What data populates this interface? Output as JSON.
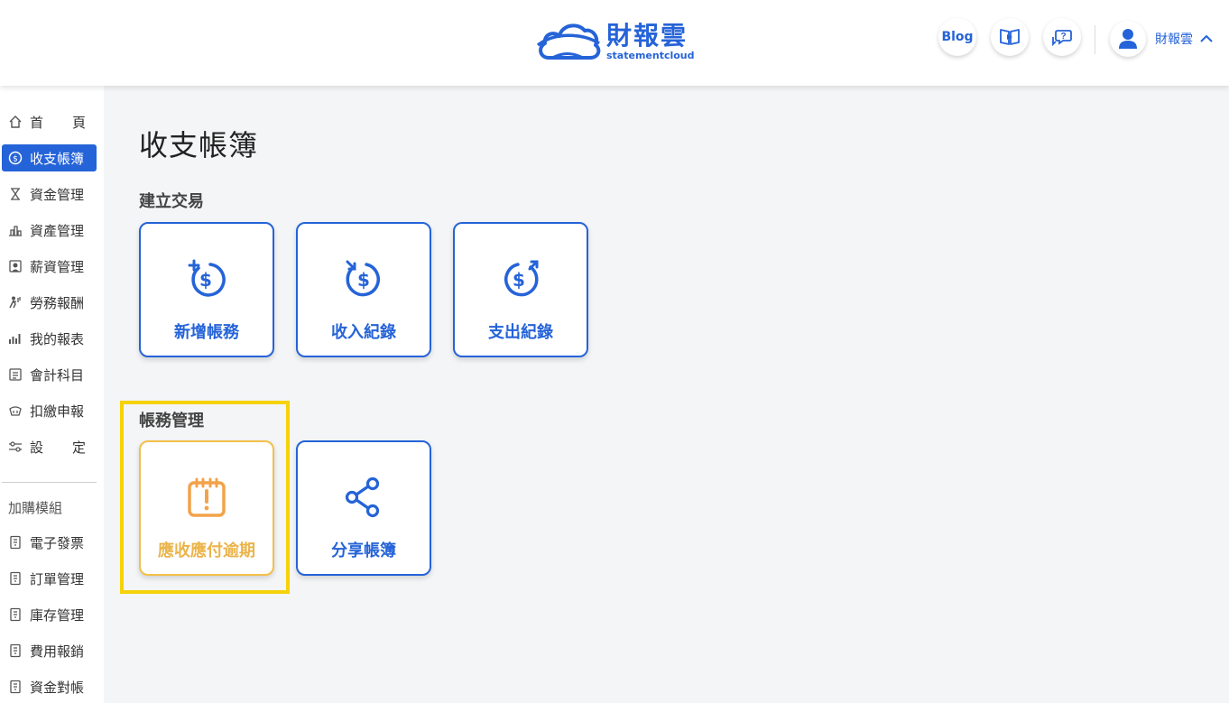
{
  "header": {
    "logo_title": "財報雲",
    "logo_sub": "statementcloud",
    "blog_label": "Blog",
    "video_icon": "video-book-icon",
    "help_icon": "help-chat-icon",
    "user_name": "財報雲"
  },
  "sidebar": {
    "items": [
      {
        "label": "首頁",
        "label_a": "首",
        "label_b": "頁",
        "icon": "home-icon"
      },
      {
        "label": "收支帳簿",
        "icon": "dollar-cycle-icon"
      },
      {
        "label": "資金管理",
        "icon": "hourglass-icon"
      },
      {
        "label": "資產管理",
        "icon": "buildings-icon"
      },
      {
        "label": "薪資管理",
        "icon": "payroll-icon"
      },
      {
        "label": "勞務報酬",
        "icon": "worker-icon"
      },
      {
        "label": "我的報表",
        "icon": "bar-chart-icon"
      },
      {
        "label": "會計科目",
        "icon": "ledger-icon"
      },
      {
        "label": "扣繳申報",
        "icon": "tax-icon"
      },
      {
        "label": "設定",
        "label_a": "設",
        "label_b": "定",
        "icon": "settings-sliders-icon"
      }
    ],
    "addon_title": "加購模組",
    "addons": [
      {
        "label": "電子發票",
        "icon": "module-icon"
      },
      {
        "label": "訂單管理",
        "icon": "module-icon"
      },
      {
        "label": "庫存管理",
        "icon": "module-icon"
      },
      {
        "label": "費用報銷",
        "icon": "module-icon"
      },
      {
        "label": "資金對帳",
        "icon": "module-icon"
      }
    ]
  },
  "main": {
    "page_title": "收支帳簿",
    "section1_title": "建立交易",
    "section1_cards": [
      {
        "label": "新增帳務",
        "icon": "add-transaction-icon"
      },
      {
        "label": "收入紀錄",
        "icon": "income-icon"
      },
      {
        "label": "支出紀錄",
        "icon": "expense-icon"
      }
    ],
    "section2_title": "帳務管理",
    "section2_cards": [
      {
        "label": "應收應付逾期",
        "icon": "overdue-calendar-icon"
      },
      {
        "label": "分享帳簿",
        "icon": "share-icon"
      }
    ]
  },
  "colors": {
    "brand": "#2563d8",
    "warn": "#ebb44a",
    "highlight": "#f5d20a"
  }
}
